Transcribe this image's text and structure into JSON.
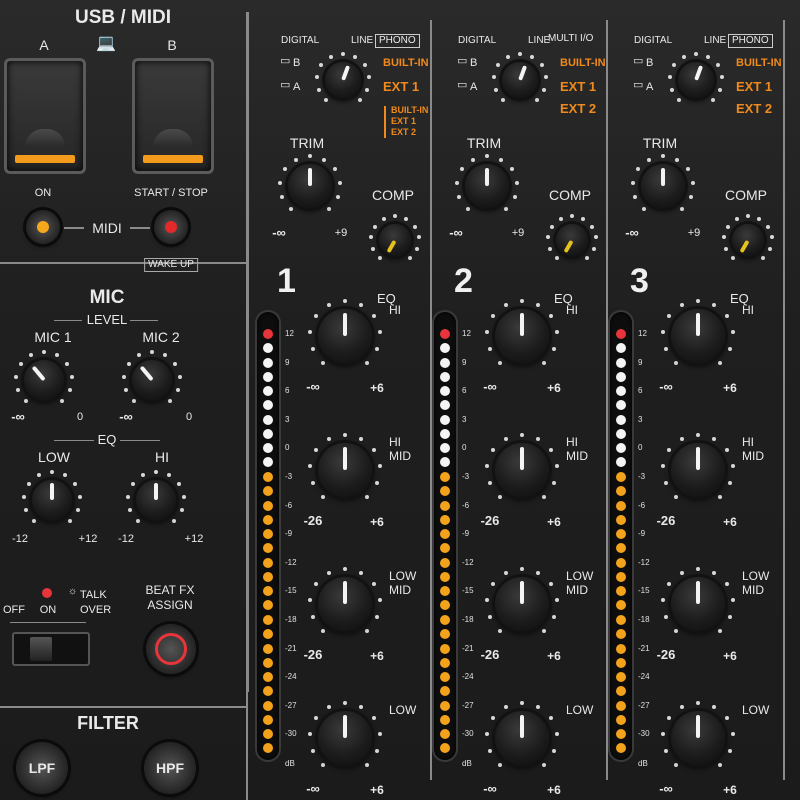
{
  "usb_midi": {
    "title": "USB / MIDI",
    "port_a": "A",
    "port_b": "B",
    "laptop_icon": "laptop-icon",
    "on_label": "ON",
    "start_stop_label": "START / STOP",
    "midi_label": "MIDI",
    "wake_up_label": "WAKE UP",
    "colors": {
      "port_bar": "#f39b1b",
      "on_led": "#f5a81c",
      "start_led": "#e22a2a"
    }
  },
  "mic": {
    "title": "MIC",
    "level_label": "LEVEL",
    "mic1_label": "MIC 1",
    "mic2_label": "MIC 2",
    "level_min": "-∞",
    "level_max": "0",
    "eq_label": "EQ",
    "low_label": "LOW",
    "hi_label": "HI",
    "eq_min": "-12",
    "eq_max": "+12",
    "off_label": "OFF",
    "on_label": "ON",
    "talk_label": "TALK",
    "over_label": "OVER",
    "beat_fx_label": "BEAT FX",
    "assign_label": "ASSIGN"
  },
  "filter": {
    "title": "FILTER",
    "lpf_label": "LPF",
    "hpf_label": "HPF"
  },
  "channels": [
    {
      "number": "1",
      "inputs": {
        "digital": "DIGITAL",
        "line": "LINE",
        "top_right": "PHONO",
        "b": "B",
        "a": "A",
        "built_in": "BUILT-IN",
        "ext1": "EXT 1",
        "ext_alt": "",
        "stack": [
          "BUILT-IN",
          "EXT 1",
          "EXT 2"
        ]
      },
      "trim_label": "TRIM",
      "trim_min": "-∞",
      "trim_max": "+9",
      "comp_label": "COMP",
      "eq_label": "EQ",
      "eq_bands": [
        {
          "label": "HI",
          "min": "-∞",
          "max": "+6"
        },
        {
          "label": "HI MID",
          "min": "-26",
          "max": "+6"
        },
        {
          "label": "LOW MID",
          "min": "-26",
          "max": "+6"
        },
        {
          "label": "LOW",
          "min": "-∞",
          "max": "+6"
        }
      ]
    },
    {
      "number": "2",
      "inputs": {
        "digital": "DIGITAL",
        "line": "LINE",
        "top_right": "MULTI I/O",
        "b": "B",
        "a": "A",
        "built_in": "BUILT-IN",
        "ext1": "EXT 1",
        "ext_alt": "EXT 2",
        "stack": []
      },
      "trim_label": "TRIM",
      "trim_min": "-∞",
      "trim_max": "+9",
      "comp_label": "COMP",
      "eq_label": "EQ",
      "eq_bands": [
        {
          "label": "HI",
          "min": "-∞",
          "max": "+6"
        },
        {
          "label": "HI MID",
          "min": "-26",
          "max": "+6"
        },
        {
          "label": "LOW MID",
          "min": "-26",
          "max": "+6"
        },
        {
          "label": "LOW",
          "min": "-∞",
          "max": "+6"
        }
      ]
    },
    {
      "number": "3",
      "inputs": {
        "digital": "DIGITAL",
        "line": "LINE",
        "top_right": "PHONO",
        "b": "B",
        "a": "A",
        "built_in": "BUILT-IN",
        "ext1": "EXT 1",
        "ext_alt": "EXT 2",
        "stack": []
      },
      "trim_label": "TRIM",
      "trim_min": "-∞",
      "trim_max": "+9",
      "comp_label": "COMP",
      "eq_label": "EQ",
      "eq_bands": [
        {
          "label": "HI",
          "min": "-∞",
          "max": "+6"
        },
        {
          "label": "HI MID",
          "min": "-26",
          "max": "+6"
        },
        {
          "label": "LOW MID",
          "min": "-26",
          "max": "+6"
        },
        {
          "label": "LOW",
          "min": "-∞",
          "max": "+6"
        }
      ]
    }
  ],
  "meter": {
    "scale": [
      "12",
      "9",
      "6",
      "3",
      "0",
      "-3",
      "-6",
      "-9",
      "-12",
      "-15",
      "-18",
      "-21",
      "-24",
      "-27",
      "-30"
    ],
    "unit": "dB",
    "colors": {
      "peak": "#e8343b",
      "high": "#f4f4f4",
      "low": "#f3a21c"
    }
  }
}
